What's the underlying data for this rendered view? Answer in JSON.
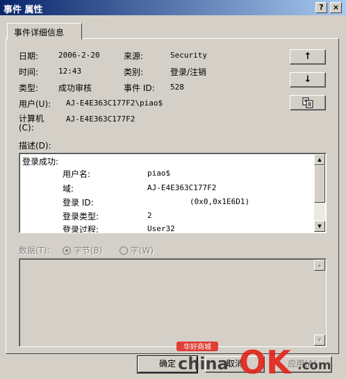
{
  "window": {
    "title": "事件 属性",
    "help_label": "?",
    "close_label": "×"
  },
  "tab": {
    "label": "事件详细信息"
  },
  "fields": {
    "date_label": "日期:",
    "date_value": "2006-2-20",
    "source_label": "来源:",
    "source_value": "Security",
    "time_label": "时间:",
    "time_value": "12:43",
    "category_label": "类别:",
    "category_value": "登录/注销",
    "type_label": "类型:",
    "type_value": "成功审核",
    "event_id_label": "事件 ID:",
    "event_id_value": "528",
    "user_label": "用户(U):",
    "user_value": "AJ-E4E363C177F2\\piao$",
    "computer_label_1": "计算机",
    "computer_label_2": "(C):",
    "computer_value": "AJ-E4E363C177F2"
  },
  "nav_buttons": {
    "up": "↑",
    "down": "↓"
  },
  "description": {
    "label": "描述(D):",
    "heading": "登录成功:",
    "rows": [
      {
        "key": "用户名:",
        "value": "piao$"
      },
      {
        "key": "域:",
        "value": "AJ-E4E363C177F2"
      },
      {
        "key": "登录 ID:",
        "value": "(0x0,0x1E6D1)"
      },
      {
        "key": "登录类型:",
        "value": "2"
      },
      {
        "key": "登录过程:",
        "value": "User32"
      }
    ]
  },
  "data_section": {
    "label": "数据(T):",
    "bytes_option": "字节(B)",
    "words_option": "字(W)"
  },
  "buttons": {
    "ok": "确定",
    "cancel": "取消",
    "apply": "应用(A)"
  },
  "watermark": {
    "top_text": "华好商城",
    "brand": "china",
    "brand_big": "OK",
    "domain": ".com"
  }
}
